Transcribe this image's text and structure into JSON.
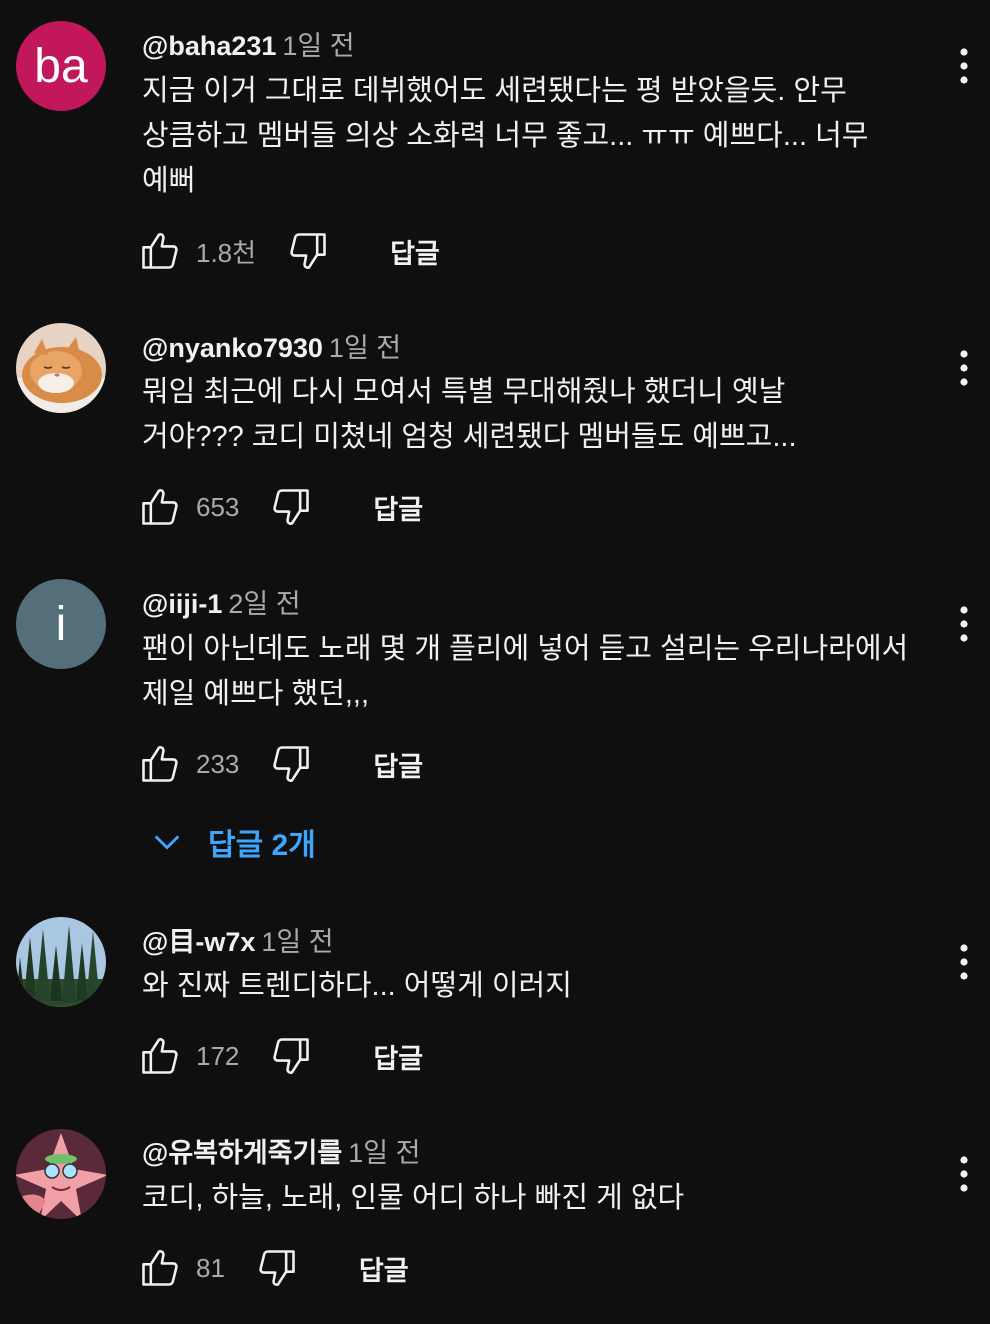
{
  "comments": [
    {
      "handle": "@baha231",
      "time": "1일 전",
      "avatar_letter": "ba",
      "avatar_color": "#c2185b",
      "text": "지금 이거 그대로 데뷔했어도 세련됐다는 평 받았을듯.  안무 상큼하고 멤버들 의상 소화력 너무 좋고... ㅠㅠ 예쁘다... 너무 예뻐",
      "likes": "1.8천",
      "reply_label": "답글"
    },
    {
      "handle": "@nyanko7930",
      "time": "1일 전",
      "avatar_icon": "cat-photo",
      "text": "뭐임 최근에 다시 모여서 특별 무대해줬나 했더니 옛날 거야??? 코디 미쳤네 엄청 세련됐다 멤버들도 예쁘고...",
      "likes": "653",
      "reply_label": "답글"
    },
    {
      "handle": "@iiji-1",
      "time": "2일 전",
      "avatar_letter": "i",
      "avatar_color": "#546e7a",
      "text": "팬이 아닌데도 노래 몇 개 플리에 넣어 듣고 설리는 우리나라에서 제일 예쁘다 했던,,,",
      "likes": "233",
      "reply_label": "답글",
      "replies_label": "답글 2개"
    },
    {
      "handle": "@目-w7x",
      "time": "1일 전",
      "avatar_icon": "forest-photo",
      "text": "와 진짜 트렌디하다... 어떻게 이러지",
      "likes": "172",
      "reply_label": "답글"
    },
    {
      "handle": "@유복하게죽기를",
      "time": "1일 전",
      "avatar_icon": "patrick-star-image",
      "text": "코디, 하늘, 노래, 인물 어디 하나 빠진 게 없다",
      "likes": "81",
      "reply_label": "답글"
    }
  ],
  "colors": {
    "background": "#0f0f0f",
    "text_primary": "#f1f1f1",
    "text_secondary": "#aaaaaa",
    "link_blue": "#3ea6ff"
  }
}
